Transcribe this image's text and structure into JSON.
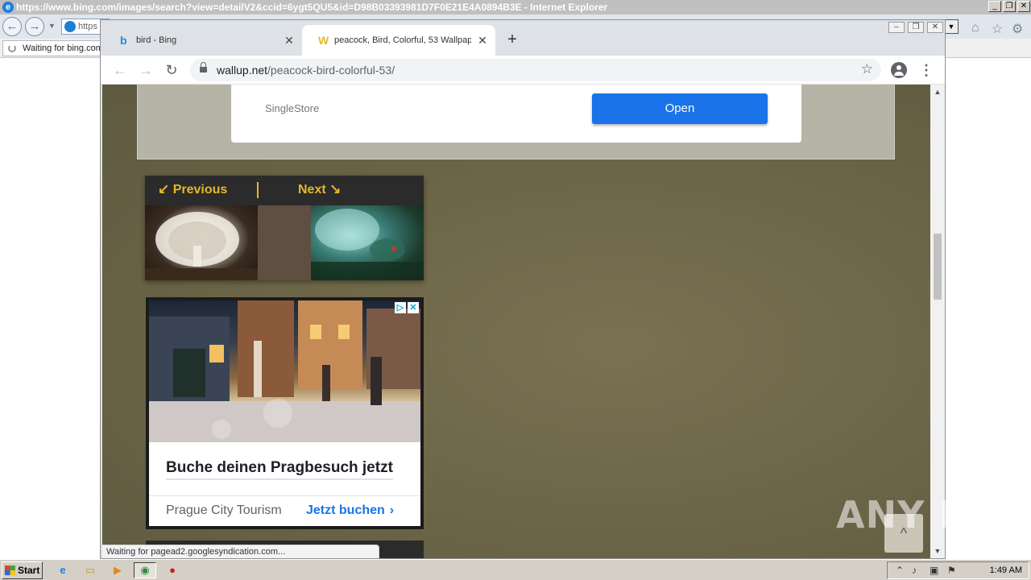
{
  "ie": {
    "title": "https://www.bing.com/images/search?view=detailV2&ccid=6ygt5QU5&id=D98B03393981D7F0E21E4A0894B3E - Internet Explorer",
    "address_text": "https",
    "tab_label": "Waiting for bing.com"
  },
  "chrome": {
    "tabs": [
      {
        "label": "bird - Bing",
        "favicon": "bing-icon"
      },
      {
        "label": "peacock, Bird, Colorful, 53 Wallpaper",
        "favicon": "wallup-icon",
        "active": true
      }
    ],
    "new_tab_symbol": "+",
    "url_host": "wallup.net",
    "url_path": "/peacock-bird-colorful-53/"
  },
  "page": {
    "top_ad": {
      "brand": "SingleStore",
      "button_label": "Open"
    },
    "pager": {
      "previous_label": "Previous",
      "next_label": "Next"
    },
    "ad": {
      "headline": "Buche deinen Pragbesuch jetzt",
      "advertiser": "Prague City Tourism",
      "cta": "Jetzt buchen"
    },
    "scroll_top_symbol": "^"
  },
  "status_text": "Waiting for pagead2.googlesyndication.com...",
  "watermark": "ANY RUN",
  "taskbar": {
    "start_label": "Start",
    "clock": "1:49 AM"
  },
  "colors": {
    "page_bg": "#6d6648",
    "accent_gold": "#e6b72b",
    "open_button": "#1a73e8",
    "cta_blue": "#1a73e8"
  }
}
